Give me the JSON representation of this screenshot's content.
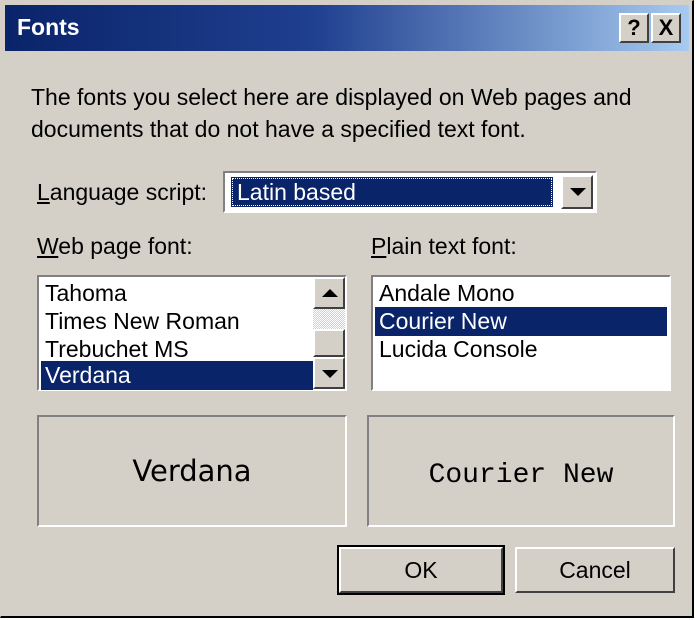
{
  "window": {
    "title": "Fonts",
    "help_label": "?",
    "close_label": "X"
  },
  "description": "The fonts you select here are displayed on Web pages and documents that do not have a specified text font.",
  "language_script": {
    "label_accesskey": "L",
    "label_rest": "anguage script:",
    "value": "Latin based"
  },
  "web_page_font": {
    "label_accesskey": "W",
    "label_rest": "eb page font:",
    "items": [
      "Tahoma",
      "Times New Roman",
      "Trebuchet MS",
      "Verdana"
    ],
    "selected": "Verdana",
    "preview": "Verdana"
  },
  "plain_text_font": {
    "label_accesskey": "P",
    "label_rest": "lain text font:",
    "items": [
      "Andale Mono",
      "Courier New",
      "Lucida Console"
    ],
    "selected": "Courier New",
    "preview": "Courier New"
  },
  "buttons": {
    "ok": "OK",
    "cancel": "Cancel"
  },
  "colors": {
    "selection": "#0a246a",
    "face": "#d4d0c8",
    "title_start": "#0a246a",
    "title_end": "#a6caf0"
  },
  "icons": {
    "help": "help-icon",
    "close": "close-icon",
    "dropdown": "chevron-down-icon"
  }
}
